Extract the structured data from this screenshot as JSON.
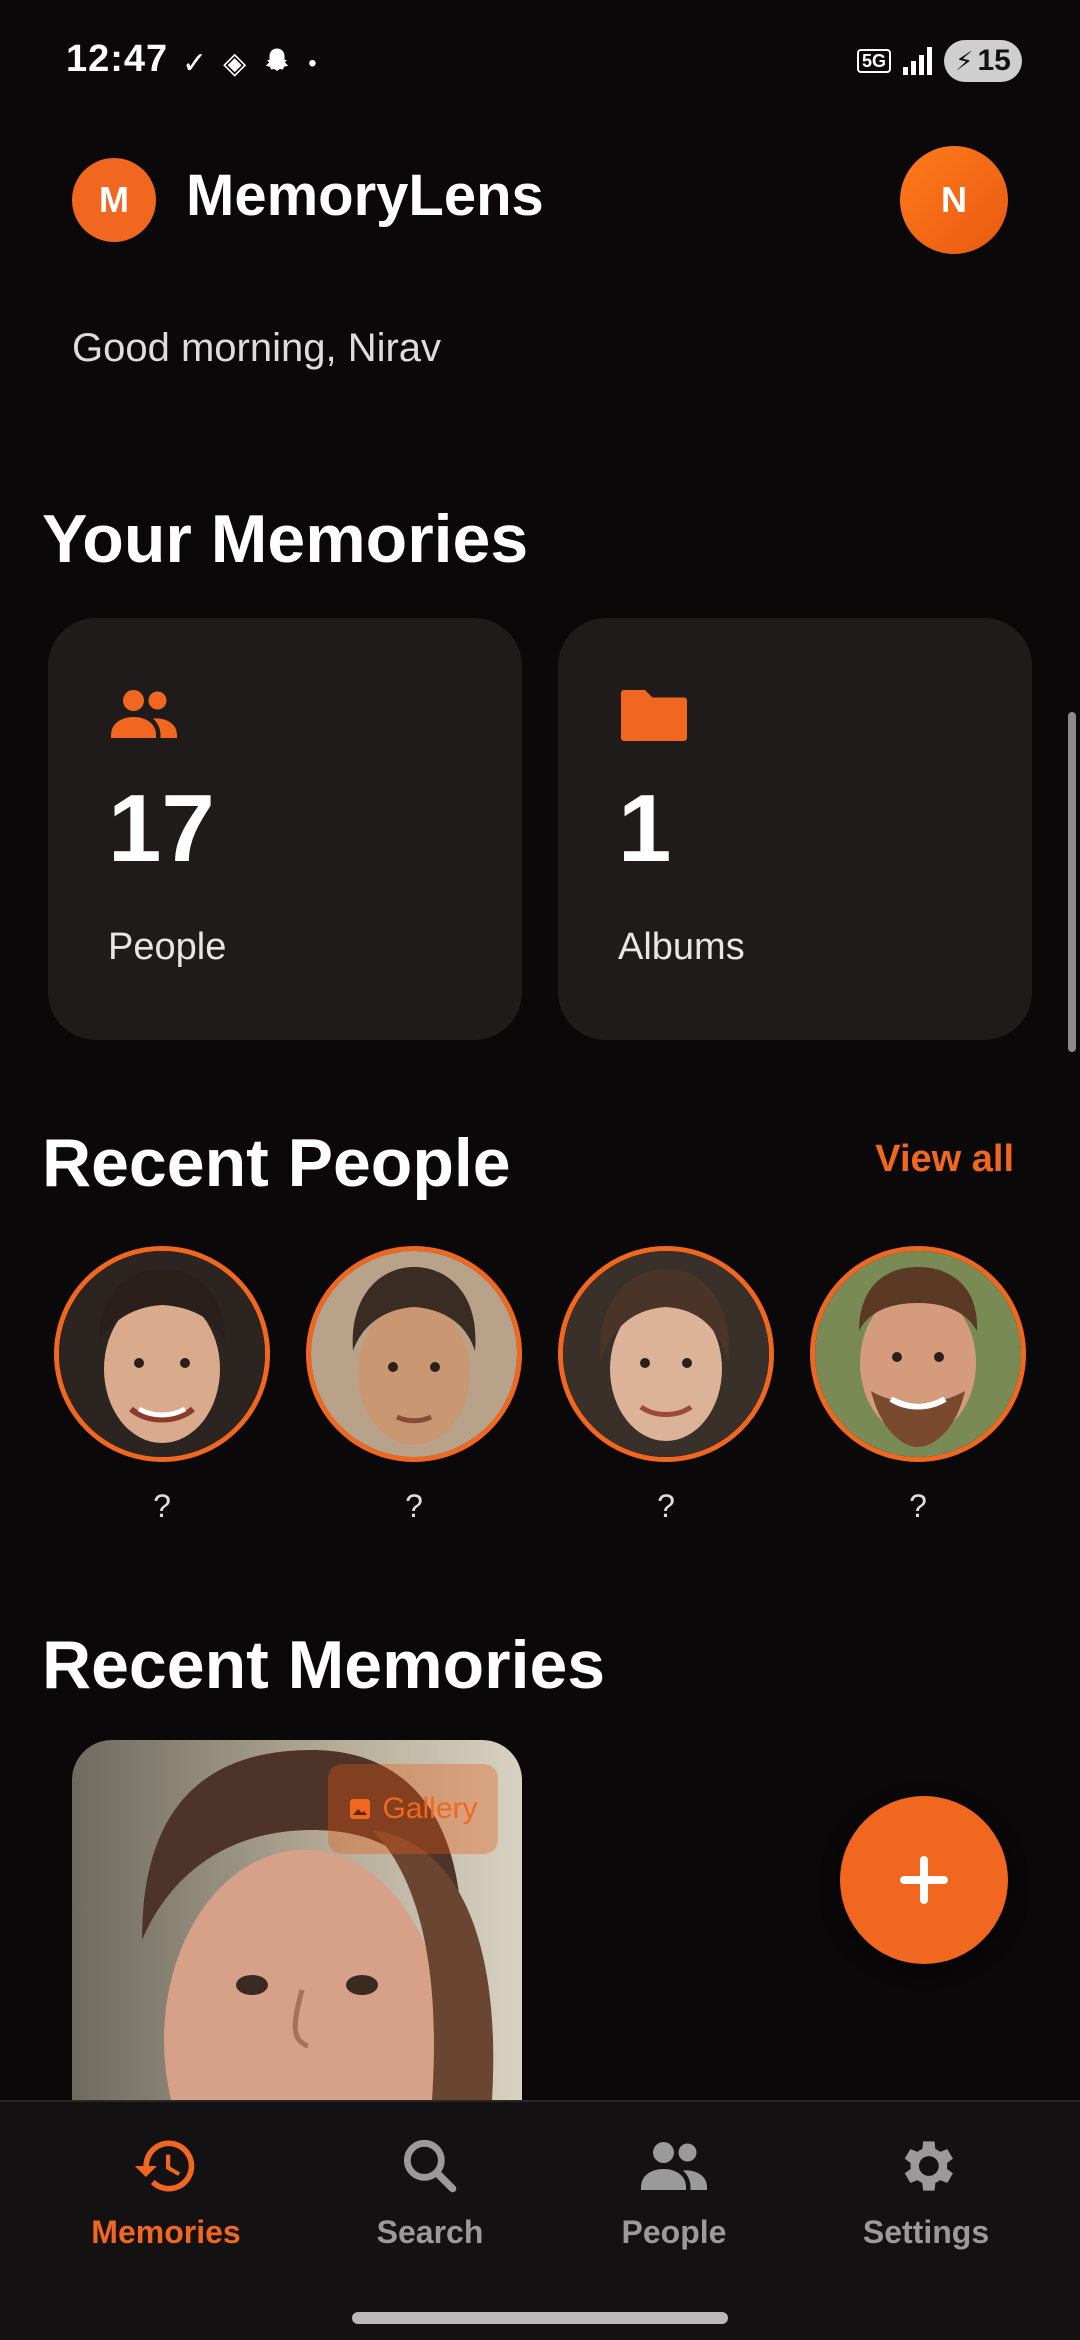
{
  "status_bar": {
    "time": "12:47",
    "network": "5G",
    "battery": "15"
  },
  "header": {
    "logo_letter": "M",
    "app_name": "MemoryLens",
    "avatar_letter": "N",
    "greeting": "Good morning, Nirav"
  },
  "your_memories": {
    "title": "Your Memories",
    "cards": [
      {
        "icon": "people-icon",
        "count": "17",
        "label": "People"
      },
      {
        "icon": "folder-icon",
        "count": "1",
        "label": "Albums"
      }
    ]
  },
  "recent_people": {
    "title": "Recent People",
    "view_all": "View all",
    "people": [
      {
        "name": "?"
      },
      {
        "name": "?"
      },
      {
        "name": "?"
      },
      {
        "name": "?"
      }
    ]
  },
  "recent_memories": {
    "title": "Recent Memories",
    "items": [
      {
        "tag": "Gallery",
        "tag_icon": "image-icon"
      }
    ]
  },
  "fab": {
    "icon": "plus-icon"
  },
  "nav": [
    {
      "label": "Memories",
      "icon": "history-icon",
      "active": true
    },
    {
      "label": "Search",
      "icon": "search-icon",
      "active": false
    },
    {
      "label": "People",
      "icon": "people-icon",
      "active": false
    },
    {
      "label": "Settings",
      "icon": "gear-icon",
      "active": false
    }
  ],
  "colors": {
    "accent": "#f2671f",
    "background": "#0a0808",
    "card": "#1e1b1a"
  }
}
